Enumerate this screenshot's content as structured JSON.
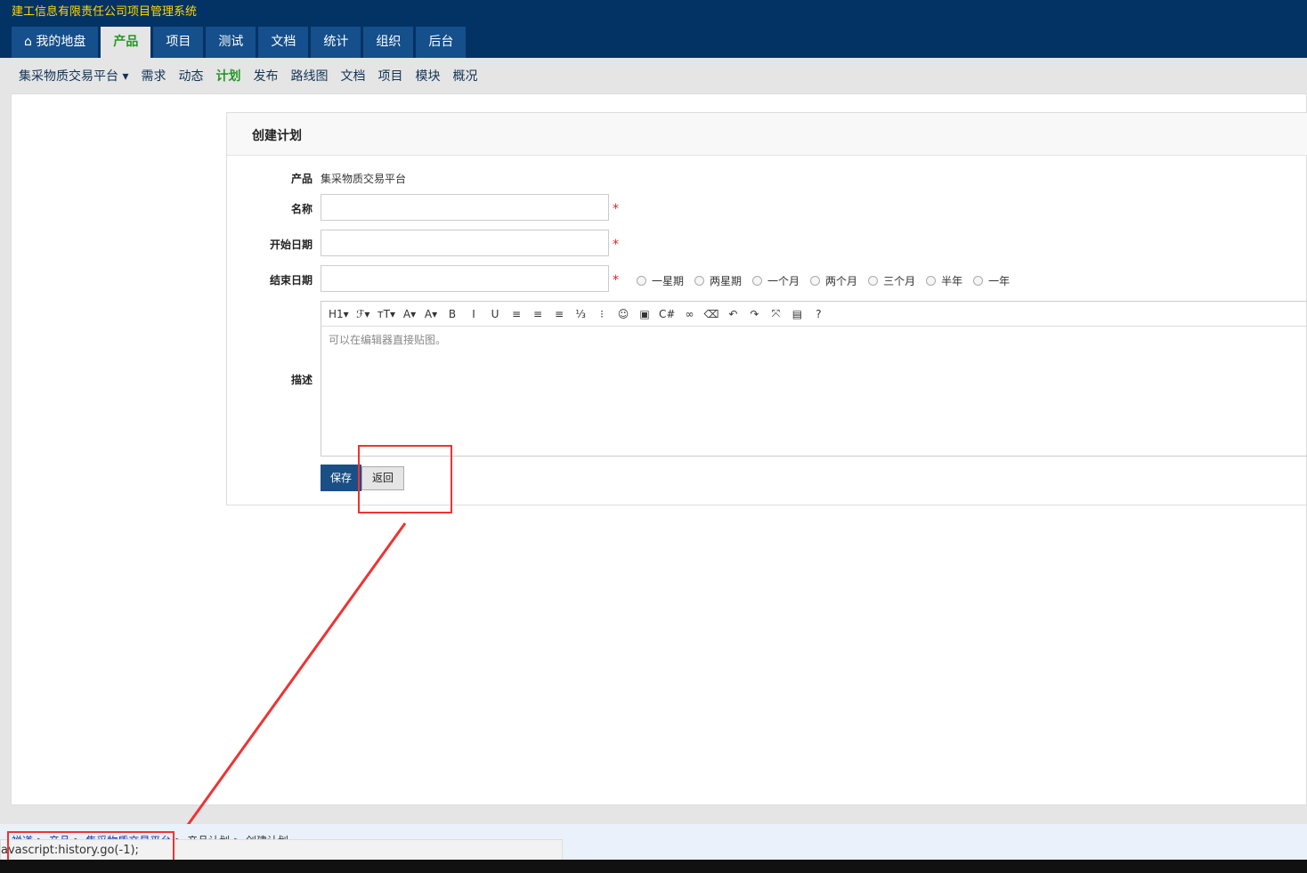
{
  "app_title": "建工信息有限责任公司项目管理系统",
  "nav": [
    "我的地盘",
    "产品",
    "项目",
    "测试",
    "文档",
    "统计",
    "组织",
    "后台"
  ],
  "subnav": {
    "product": "集采物质交易平台",
    "items": [
      "需求",
      "动态",
      "计划",
      "发布",
      "路线图",
      "文档",
      "项目",
      "模块",
      "概况"
    ]
  },
  "form": {
    "heading": "创建计划",
    "product_label": "产品",
    "product_value": "集采物质交易平台",
    "name_label": "名称",
    "begin_label": "开始日期",
    "end_label": "结束日期",
    "required": "*",
    "durations": [
      "一星期",
      "两星期",
      "一个月",
      "两个月",
      "三个月",
      "半年",
      "一年"
    ],
    "desc_label": "描述",
    "editor_placeholder": "可以在编辑器直接贴图。",
    "save": "保存",
    "back": "返回"
  },
  "toolbar": [
    "H1▾",
    "ℱ▾",
    "тT▾",
    "A▾",
    "A▾",
    "B",
    "I",
    "U",
    "≡",
    "≡",
    "≡",
    "⅓",
    "⁝",
    "☺",
    "▣",
    "C#",
    "∞",
    "⌫",
    "↶",
    "↷",
    "⤧",
    "▤",
    "?"
  ],
  "breadcrumb": [
    "禅道",
    "产品",
    "集采物质交易平台",
    "产品计划",
    "创建计划"
  ],
  "status_url": "avascript:history.go(-1);"
}
